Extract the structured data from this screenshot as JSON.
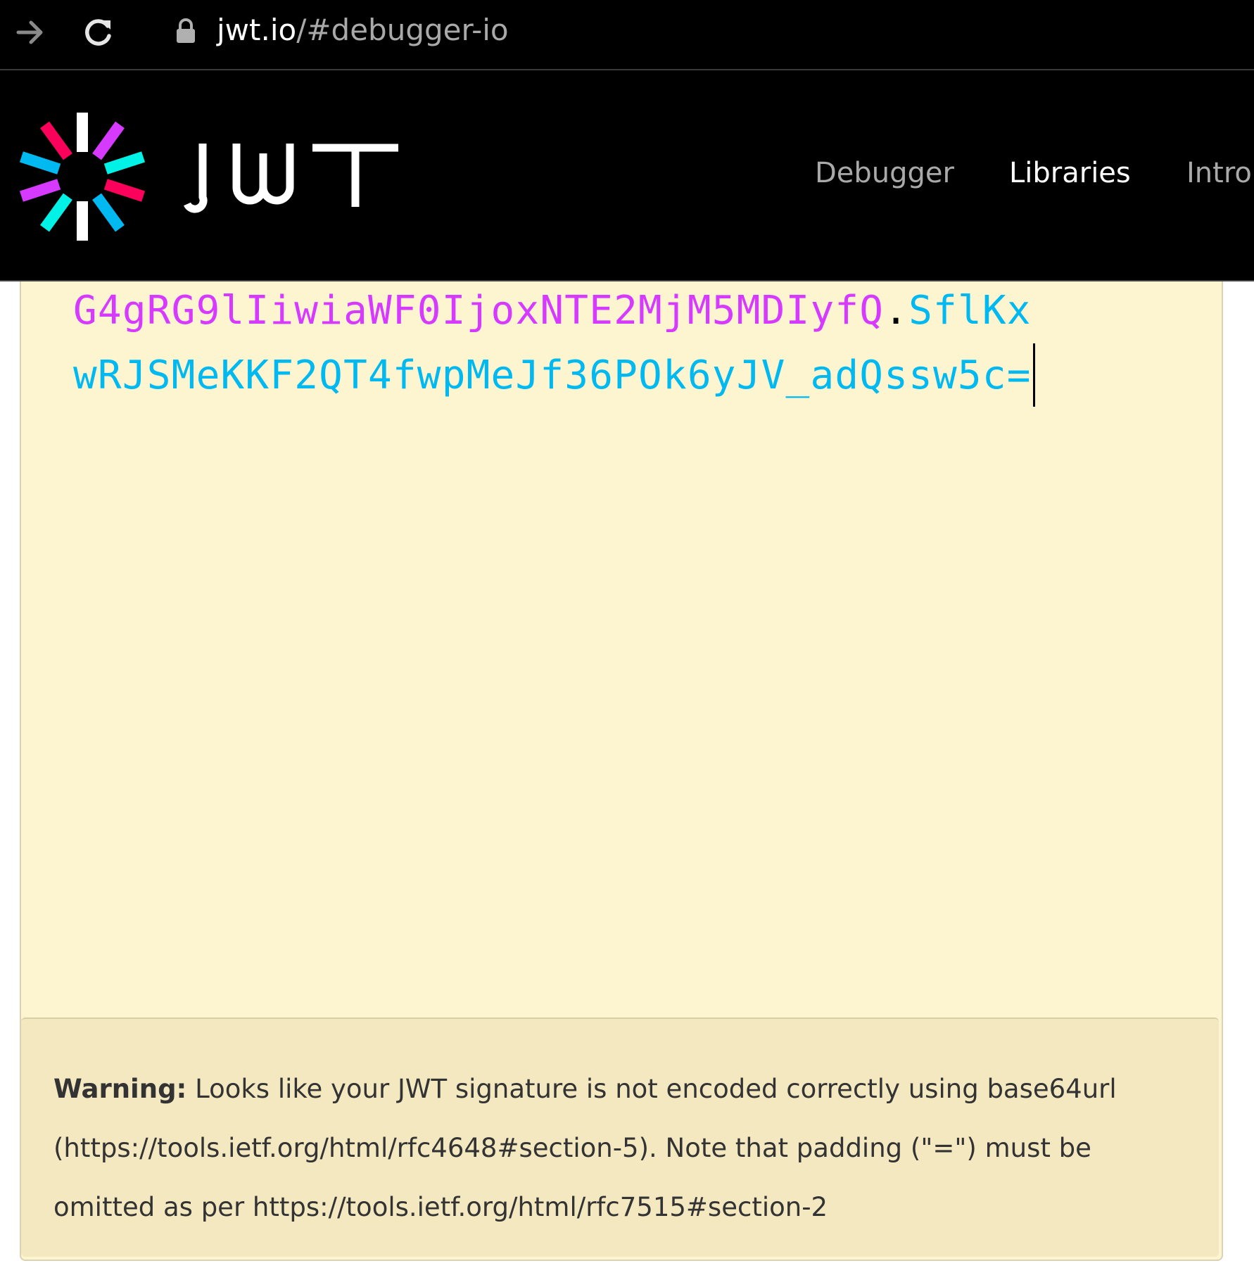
{
  "browser": {
    "url_host": "jwt.io",
    "url_path": "/#debugger-io"
  },
  "header": {
    "logo_text": "JWT",
    "nav": [
      {
        "label": "Debugger"
      },
      {
        "label": "Libraries"
      },
      {
        "label": "Intro"
      }
    ]
  },
  "editor": {
    "line1_payload": "G4gRG9lIiwiaWF0IjoxNTE2MjM5MDIyfQ",
    "line1_dot": ".",
    "line1_sig": "SflKx",
    "line2_sig": "wRJSMeKKF2QT4fwpMeJf36POk6yJV_adQssw5c="
  },
  "warning": {
    "label": "Warning:",
    "message": " Looks like your JWT signature is not encoded correctly using base64url (https://tools.ietf.org/html/rfc4648#section-5). Note that padding (\"=\") must be omitted as per https://tools.ietf.org/html/rfc7515#section-2"
  },
  "colors": {
    "payload": "#d63aff",
    "signature": "#00b9f1",
    "editor_bg": "#fdf5cf",
    "warning_bg": "#f3e8c0"
  }
}
